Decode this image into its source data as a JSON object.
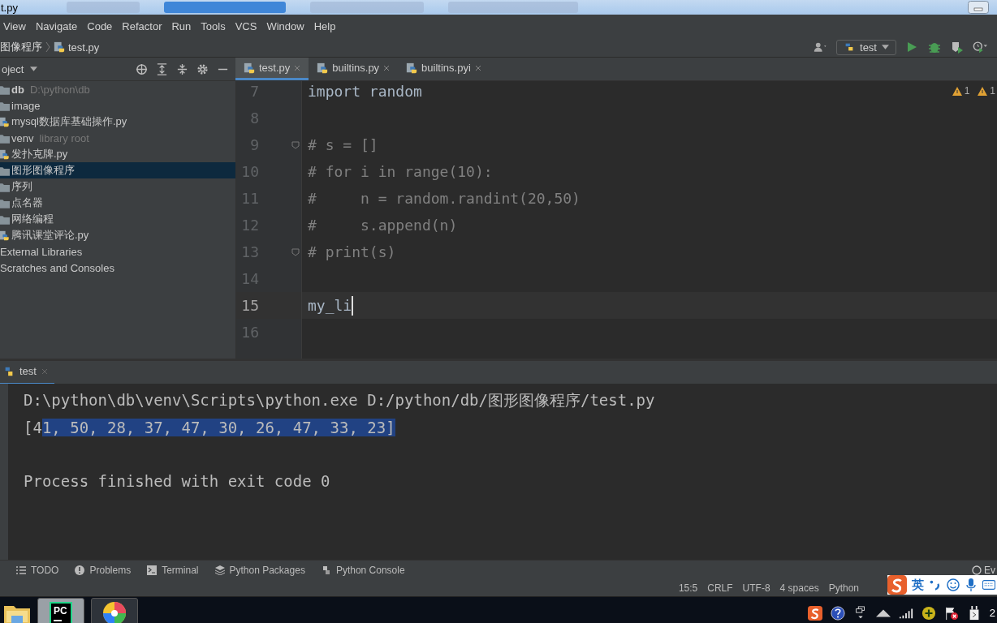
{
  "window": {
    "title": "t.py"
  },
  "menu": [
    "View",
    "Navigate",
    "Code",
    "Refactor",
    "Run",
    "Tools",
    "VCS",
    "Window",
    "Help"
  ],
  "breadcrumb": [
    "图像程序",
    "test.py"
  ],
  "run_config": {
    "label": "test"
  },
  "project_panel": {
    "title": "oject"
  },
  "editor_tabs": [
    {
      "label": "test.py",
      "selected": true
    },
    {
      "label": "builtins.py",
      "selected": false
    },
    {
      "label": "builtins.pyi",
      "selected": false
    }
  ],
  "tree": [
    {
      "kind": "folder",
      "label": "db",
      "hint": "D:\\python\\db",
      "selected": false,
      "children": [
        {
          "kind": "folder",
          "label": "image",
          "selected": false
        },
        {
          "kind": "python",
          "label": "mysql数据库基础操作.py",
          "selected": false
        },
        {
          "kind": "folder",
          "label": "venv",
          "hint": "library root",
          "selected": false
        },
        {
          "kind": "python",
          "label": "发扑克牌.py",
          "selected": false
        },
        {
          "kind": "folder",
          "label": "图形图像程序",
          "selected": true
        },
        {
          "kind": "folder",
          "label": "序列",
          "selected": false
        },
        {
          "kind": "folder",
          "label": "点名器",
          "selected": false
        },
        {
          "kind": "folder",
          "label": "网络编程",
          "selected": false
        },
        {
          "kind": "python",
          "label": "腾讯课堂评论.py",
          "selected": false
        }
      ]
    },
    {
      "kind": "library",
      "label": "External Libraries",
      "selected": false
    },
    {
      "kind": "library",
      "label": "Scratches and Consoles",
      "selected": false
    }
  ],
  "warnings": [
    "1",
    "1"
  ],
  "code": [
    {
      "number": "7",
      "text": "import random",
      "current": false,
      "fold": false
    },
    {
      "number": "8",
      "current": false,
      "fold": false
    },
    {
      "number": "9",
      "text": "# s = []",
      "current": false,
      "fold": true
    },
    {
      "number": "10",
      "text": "# for i in range(10):",
      "current": false,
      "fold": false
    },
    {
      "number": "11",
      "text": "#     n = random.randint(20,50)",
      "current": false,
      "fold": false
    },
    {
      "number": "12",
      "text": "#     s.append(n)",
      "current": false,
      "fold": false
    },
    {
      "number": "13",
      "text": "# print(s)",
      "current": false,
      "fold": true
    },
    {
      "number": "14",
      "current": false,
      "fold": false
    },
    {
      "number": "15",
      "text": "my_li",
      "current": true,
      "fold": false
    },
    {
      "number": "16",
      "current": false,
      "fold": false
    }
  ],
  "run_panel": {
    "tab": "test"
  },
  "console": [
    {
      "kind": "output",
      "text": "D:\\python\\db\\venv\\Scripts\\python.exe D:/python/db/图形图像程序/test.py"
    },
    {
      "kind": "selection",
      "text": "[4",
      "selected_text": "1, 50, 28, 37, 47, 30, 26, 47, 33, 23]"
    },
    {
      "kind": "blank"
    },
    {
      "kind": "output",
      "text": "Process finished with exit code 0"
    }
  ],
  "tool_windows": [
    {
      "kind": "todo",
      "label": "TODO"
    },
    {
      "kind": "problems",
      "label": "Problems"
    },
    {
      "kind": "terminal",
      "label": "Terminal"
    },
    {
      "kind": "packages",
      "label": "Python Packages"
    },
    {
      "kind": "console",
      "label": "Python Console"
    }
  ],
  "event_log": "Ev",
  "status_bar": [
    "15:5",
    "CRLF",
    "UTF-8",
    "4 spaces",
    "Python"
  ],
  "ime": {
    "mode": "英"
  },
  "taskbar": {
    "pycharm_label": "PC",
    "clock": "2"
  }
}
